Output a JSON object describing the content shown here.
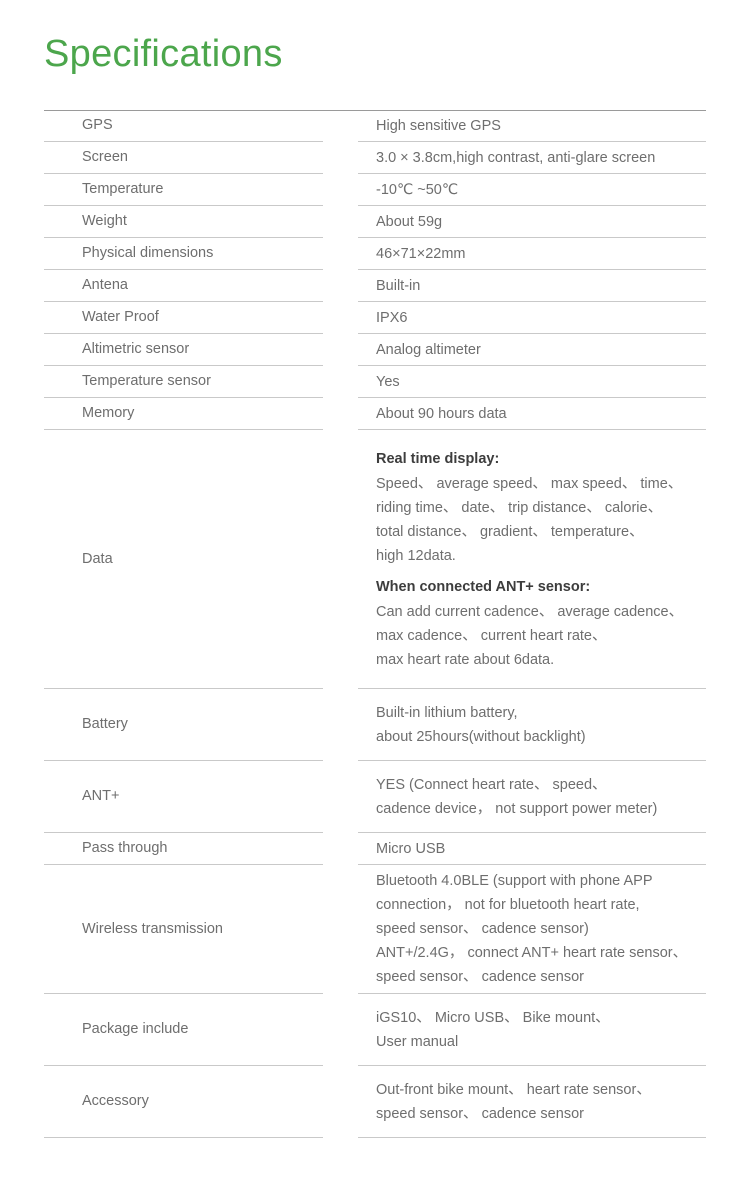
{
  "page": {
    "title": "Specifications",
    "title_color": "#4ca64c",
    "text_color": "#6e6e6e",
    "rule_color": "#c9c9c9"
  },
  "table": {
    "rows": [
      {
        "label": "GPS",
        "value": "High sensitive GPS"
      },
      {
        "label": "Screen",
        "value": "3.0 × 3.8cm,high contrast, anti-glare screen"
      },
      {
        "label": "Temperature",
        "value": "-10℃ ~50℃"
      },
      {
        "label": "Weight",
        "value": "About 59g"
      },
      {
        "label": "Physical dimensions",
        "value": "46×71×22mm"
      },
      {
        "label": "Antena",
        "value": "Built-in"
      },
      {
        "label": "Water Proof",
        "value": "IPX6"
      },
      {
        "label": "Altimetric sensor",
        "value": "Analog altimeter"
      },
      {
        "label": "Temperature sensor",
        "value": "Yes"
      },
      {
        "label": "Memory",
        "value": "About 90 hours data"
      }
    ],
    "data_row": {
      "label": "Data",
      "group1_heading": "Real time display:",
      "group1_lines": [
        "Speed、 average speed、 max speed、 time、",
        "riding time、 date、 trip distance、 calorie、",
        "total distance、 gradient、 temperature、",
        "high 12data."
      ],
      "group2_heading": "When connected ANT+ sensor:",
      "group2_lines": [
        "Can add current cadence、 average cadence、",
        "max cadence、 current heart rate、",
        "max heart rate about 6data."
      ]
    },
    "battery_row": {
      "label": "Battery",
      "lines": [
        "Built-in lithium battery,",
        "about 25hours(without backlight)"
      ]
    },
    "ant_row": {
      "label": "ANT+",
      "lines": [
        "YES (Connect heart rate、 speed、",
        "cadence device， not support power meter)"
      ]
    },
    "pass_through_row": {
      "label": "Pass through",
      "value": "Micro USB"
    },
    "wireless_row": {
      "label": "Wireless transmission",
      "lines": [
        "Bluetooth 4.0BLE (support with phone APP",
        "connection， not for bluetooth heart rate,",
        "speed sensor、 cadence sensor)",
        "ANT+/2.4G， connect ANT+ heart rate sensor、",
        "speed sensor、 cadence sensor"
      ]
    },
    "package_row": {
      "label": "Package include",
      "lines": [
        "iGS10、 Micro USB、 Bike mount、",
        "User manual"
      ]
    },
    "accessory_row": {
      "label": "Accessory",
      "lines": [
        "Out-front bike mount、 heart rate sensor、",
        "speed sensor、 cadence sensor"
      ]
    }
  }
}
